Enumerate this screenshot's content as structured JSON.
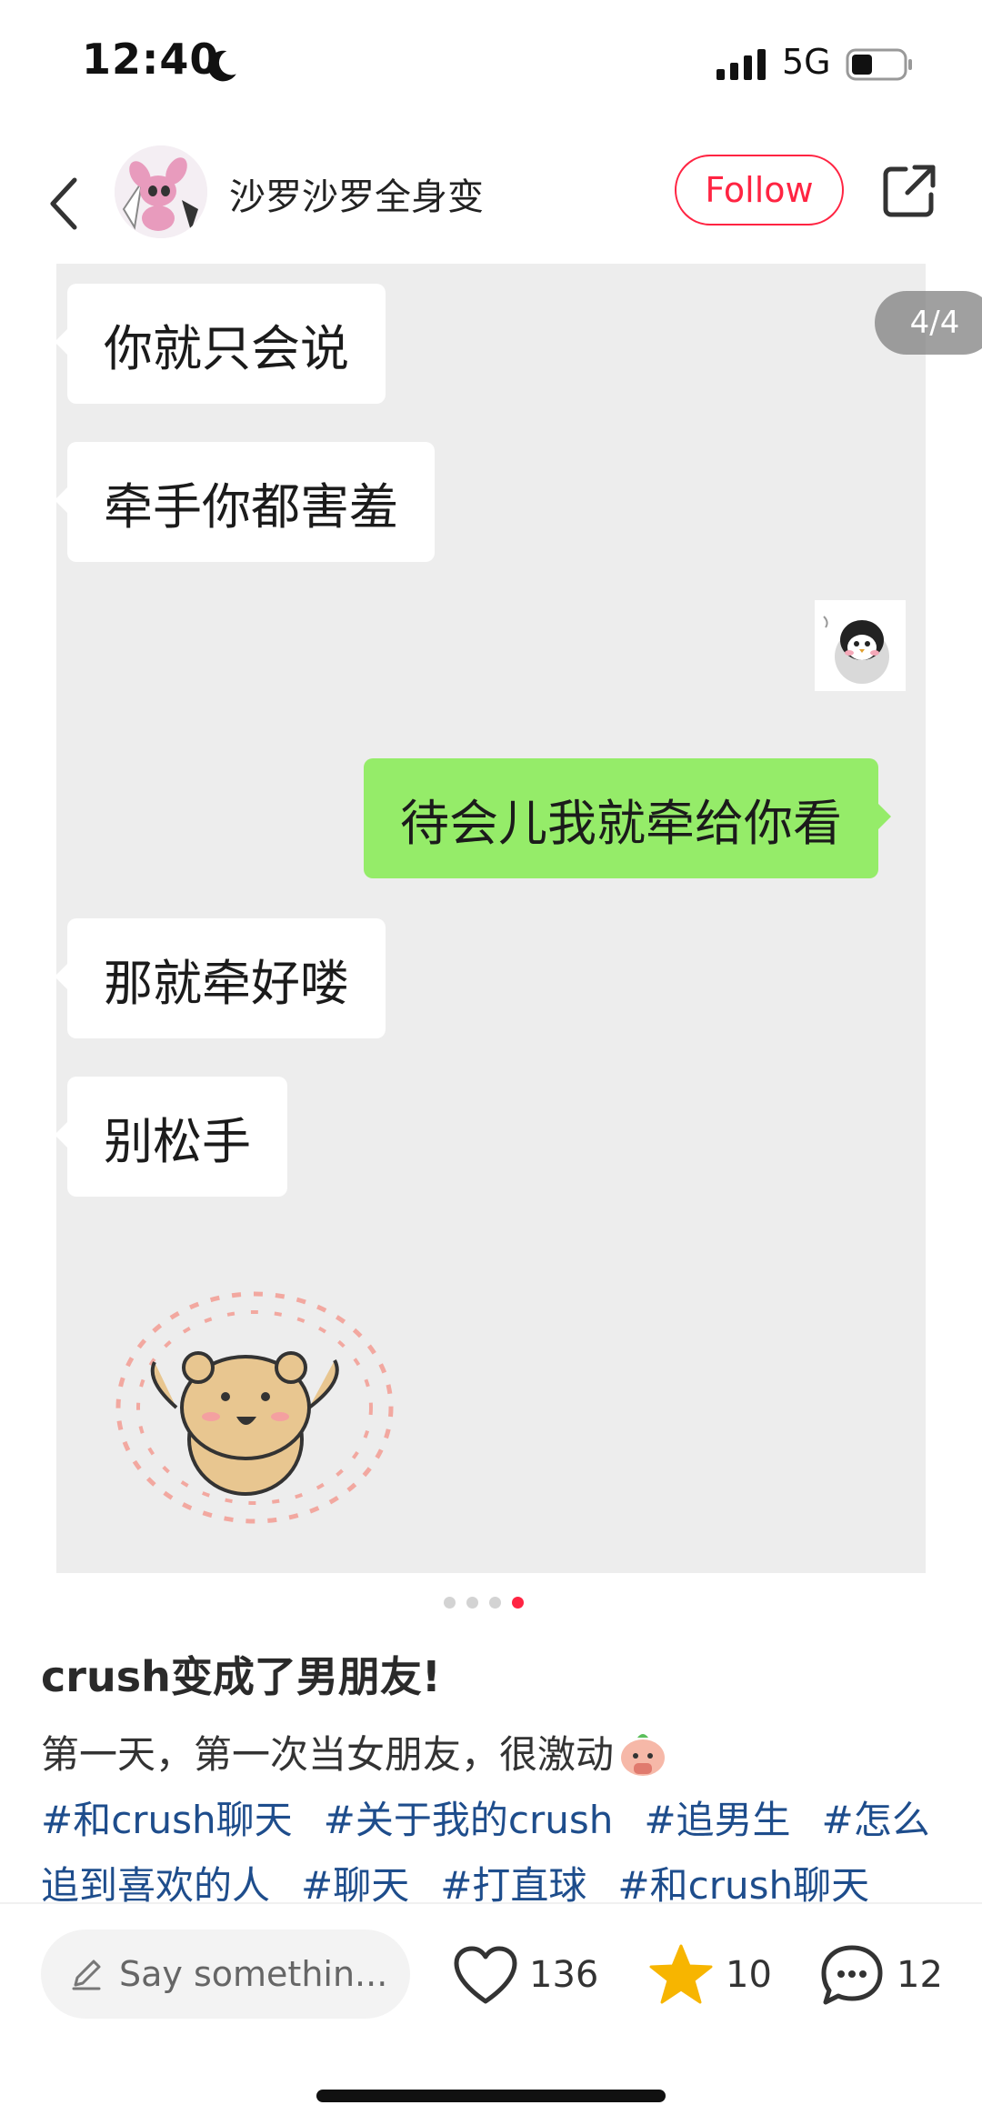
{
  "status_bar": {
    "time": "12:40",
    "network": "5G"
  },
  "header": {
    "author_name": "沙罗沙罗全身变",
    "follow_label": "Follow"
  },
  "image": {
    "page_indicator": "4/4",
    "messages": [
      {
        "side": "left",
        "text": "你就只会说"
      },
      {
        "side": "left",
        "text": "牵手你都害羞"
      },
      {
        "side": "right",
        "text": "待会儿我就牵给你看"
      },
      {
        "side": "left",
        "text": "那就牵好喽"
      },
      {
        "side": "left",
        "text": "别松手"
      }
    ],
    "dots_total": 4,
    "dots_active": 4
  },
  "post": {
    "title": "crush变成了男朋友!",
    "body": "第一天，第一次当女朋友，很激动",
    "tags": [
      "#和crush聊天",
      "#关于我的crush",
      "#追男生",
      "#怎么追到喜欢的人",
      "#聊天",
      "#打直球",
      "#和crush聊天"
    ]
  },
  "bottom_bar": {
    "comment_placeholder": "Say somethin...",
    "likes": "136",
    "collects": "10",
    "comments": "12"
  },
  "colors": {
    "accent": "#ff2442",
    "bubble_green": "#95ec69",
    "tag_blue": "#1e4d8c"
  }
}
